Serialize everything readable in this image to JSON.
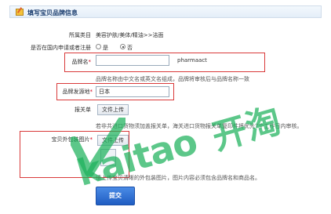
{
  "header": {
    "title": "填写宝贝品牌信息"
  },
  "category": {
    "label": "所属类目",
    "value": "美容护肤/美体/精油>>洁面"
  },
  "registration": {
    "label": "是否在国内申请或者注册",
    "options": [
      {
        "label": "是",
        "checked": false
      },
      {
        "label": "否",
        "checked": true
      }
    ]
  },
  "brand_name": {
    "label": "品牌名",
    "required_mark": "*",
    "value": "",
    "side_text": "pharmaact",
    "hint": "品牌名称由中文名或英文名组成，品牌将审核后与品牌名称一致"
  },
  "origin": {
    "label": "品牌发源地",
    "required_mark": "*",
    "value": "日本"
  },
  "customs": {
    "label": "报关单",
    "button": "文件上传",
    "hint": "若非共进口货物须加盖报关单，海关进口货物报关单复印件将优先7个工作日内审核。"
  },
  "package_image": {
    "label": "宝贝外包装图片",
    "required_mark": "*",
    "button": "文件上传",
    "hint": "请上传宝贝清晰的外包装图片，图片内容必须包含品牌名和商品名。"
  },
  "submit": {
    "label": "提交"
  },
  "watermark": {
    "latin": "kaitao",
    "cjk": "开淘",
    "color": "#1db25b"
  }
}
